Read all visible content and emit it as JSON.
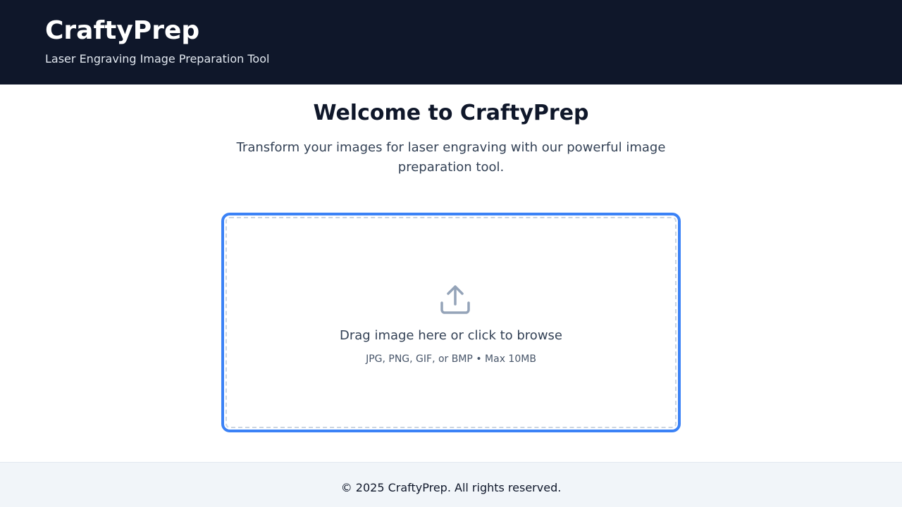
{
  "header": {
    "title": "CraftyPrep",
    "subtitle": "Laser Engraving Image Preparation Tool"
  },
  "main": {
    "welcome_title": "Welcome to CraftyPrep",
    "welcome_text": "Transform your images for laser engraving with our powerful image preparation tool."
  },
  "dropzone": {
    "icon": "upload-icon",
    "prompt": "Drag image here or click to browse",
    "hint": "JPG, PNG, GIF, or BMP • Max 10MB"
  },
  "footer": {
    "copyright": "© 2025 CraftyPrep. All rights reserved."
  },
  "colors": {
    "header_bg": "#0f172a",
    "accent": "#3b82f6",
    "footer_bg": "#f1f5f9"
  }
}
